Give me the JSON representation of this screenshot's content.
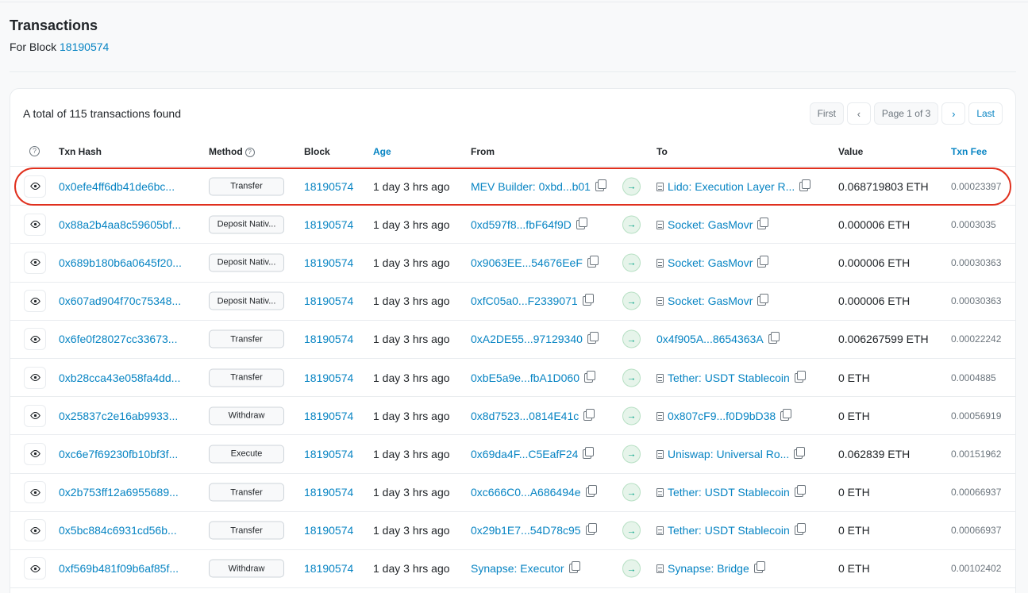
{
  "header": {
    "title": "Transactions",
    "sub_prefix": "For Block",
    "block_number": "18190574"
  },
  "card": {
    "total_text": "A total of 115 transactions found",
    "pager": {
      "first": "First",
      "page": "Page 1 of 3",
      "last": "Last",
      "prev_icon": "chevron-left-icon",
      "next_icon": "chevron-right-icon"
    }
  },
  "columns": {
    "txn_hash": "Txn Hash",
    "method": "Method",
    "block": "Block",
    "age": "Age",
    "from": "From",
    "to": "To",
    "value": "Value",
    "fee": "Txn Fee"
  },
  "rows": [
    {
      "hash": "0x0efe4ff6db41de6bc...",
      "method": "Transfer",
      "block": "18190574",
      "age": "1 day 3 hrs ago",
      "from": "MEV Builder: 0xbd...b01",
      "to": "Lido: Execution Layer R...",
      "to_contract": true,
      "value": "0.068719803 ETH",
      "fee": "0.00023397"
    },
    {
      "hash": "0x88a2b4aa8c59605bf...",
      "method": "Deposit Nativ...",
      "block": "18190574",
      "age": "1 day 3 hrs ago",
      "from": "0xd597f8...fbF64f9D",
      "to": "Socket: GasMovr",
      "to_contract": true,
      "value": "0.000006 ETH",
      "fee": "0.0003035"
    },
    {
      "hash": "0x689b180b6a0645f20...",
      "method": "Deposit Nativ...",
      "block": "18190574",
      "age": "1 day 3 hrs ago",
      "from": "0x9063EE...54676EeF",
      "to": "Socket: GasMovr",
      "to_contract": true,
      "value": "0.000006 ETH",
      "fee": "0.00030363"
    },
    {
      "hash": "0x607ad904f70c75348...",
      "method": "Deposit Nativ...",
      "block": "18190574",
      "age": "1 day 3 hrs ago",
      "from": "0xfC05a0...F2339071",
      "to": "Socket: GasMovr",
      "to_contract": true,
      "value": "0.000006 ETH",
      "fee": "0.00030363"
    },
    {
      "hash": "0x6fe0f28027cc33673...",
      "method": "Transfer",
      "block": "18190574",
      "age": "1 day 3 hrs ago",
      "from": "0xA2DE55...97129340",
      "to": "0x4f905A...8654363A",
      "to_contract": false,
      "value": "0.006267599 ETH",
      "fee": "0.00022242"
    },
    {
      "hash": "0xb28cca43e058fa4dd...",
      "method": "Transfer",
      "block": "18190574",
      "age": "1 day 3 hrs ago",
      "from": "0xbE5a9e...fbA1D060",
      "to": "Tether: USDT Stablecoin",
      "to_contract": true,
      "value": "0 ETH",
      "fee": "0.0004885"
    },
    {
      "hash": "0x25837c2e16ab9933...",
      "method": "Withdraw",
      "block": "18190574",
      "age": "1 day 3 hrs ago",
      "from": "0x8d7523...0814E41c",
      "to": "0x807cF9...f0D9bD38",
      "to_contract": true,
      "value": "0 ETH",
      "fee": "0.00056919"
    },
    {
      "hash": "0xc6e7f69230fb10bf3f...",
      "method": "Execute",
      "block": "18190574",
      "age": "1 day 3 hrs ago",
      "from": "0x69da4F...C5EafF24",
      "to": "Uniswap: Universal Ro...",
      "to_contract": true,
      "value": "0.062839 ETH",
      "fee": "0.00151962"
    },
    {
      "hash": "0x2b753ff12a6955689...",
      "method": "Transfer",
      "block": "18190574",
      "age": "1 day 3 hrs ago",
      "from": "0xc666C0...A686494e",
      "to": "Tether: USDT Stablecoin",
      "to_contract": true,
      "value": "0 ETH",
      "fee": "0.00066937"
    },
    {
      "hash": "0x5bc884c6931cd56b...",
      "method": "Transfer",
      "block": "18190574",
      "age": "1 day 3 hrs ago",
      "from": "0x29b1E7...54D78c95",
      "to": "Tether: USDT Stablecoin",
      "to_contract": true,
      "value": "0 ETH",
      "fee": "0.00066937"
    },
    {
      "hash": "0xf569b481f09b6af85f...",
      "method": "Withdraw",
      "block": "18190574",
      "age": "1 day 3 hrs ago",
      "from": "Synapse: Executor",
      "to": "Synapse: Bridge",
      "to_contract": true,
      "value": "0 ETH",
      "fee": "0.00102402"
    }
  ],
  "colors": {
    "link": "#0784c3",
    "highlight": "#e0301e"
  }
}
